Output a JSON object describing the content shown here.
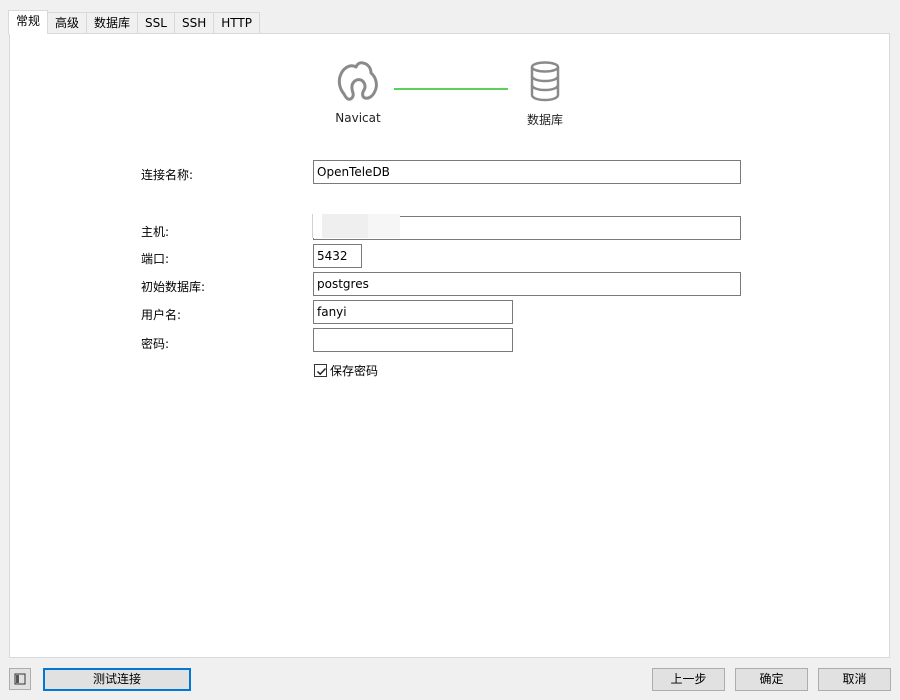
{
  "tabs": [
    {
      "label": "常规",
      "active": true
    },
    {
      "label": "高级"
    },
    {
      "label": "数据库"
    },
    {
      "label": "SSL"
    },
    {
      "label": "SSH"
    },
    {
      "label": "HTTP"
    }
  ],
  "diagram": {
    "left_label": "Navicat",
    "right_label": "数据库",
    "connector_color": "#5ccf5c"
  },
  "form": {
    "connection_name": {
      "label": "连接名称:",
      "value": "OpenTeleDB"
    },
    "host": {
      "label": "主机:",
      "value": ""
    },
    "port": {
      "label": "端口:",
      "value": "5432"
    },
    "initial_db": {
      "label": "初始数据库:",
      "value": "postgres"
    },
    "username": {
      "label": "用户名:",
      "value": "fanyi"
    },
    "password": {
      "label": "密码:",
      "value": ""
    },
    "save_password": {
      "label": "保存密码",
      "checked": true
    }
  },
  "buttons": {
    "test_connection": "测试连接",
    "previous": "上一步",
    "ok": "确定",
    "cancel": "取消"
  },
  "colors": {
    "accent": "#0078d7",
    "connector": "#5ccf5c"
  }
}
